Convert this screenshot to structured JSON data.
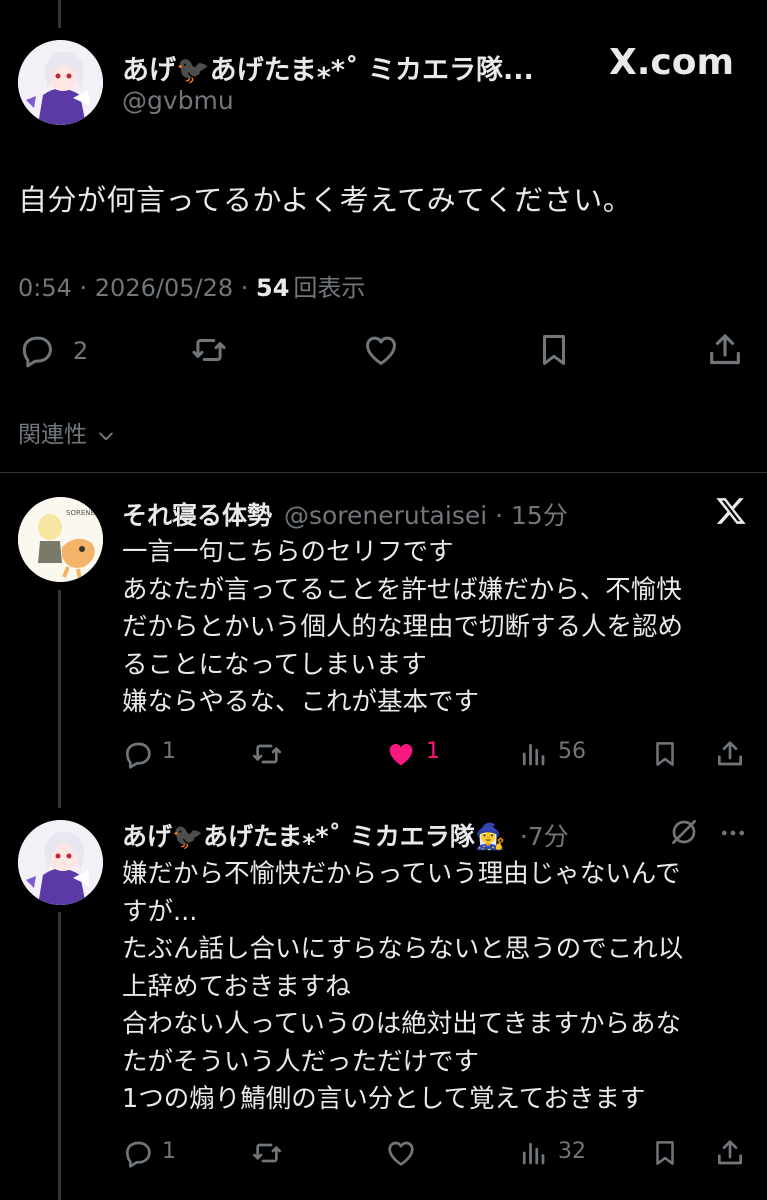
{
  "main_tweet": {
    "display_name": "あげ🐦‍⬛あげたま⁎*˚ ミカエラ隊...",
    "handle": "@gvbmu",
    "site_label": "X.com",
    "text": "自分が何言ってるかよく考えてみてください。",
    "timestamp": "0:54 · 2026/05/28 · ",
    "views_count": "54",
    "views_label": "回表示",
    "reply_count": "2",
    "relevance_label": "関連性"
  },
  "replies": [
    {
      "display_name": "それ寝る体勢",
      "handle": "@sorenerutaisei",
      "time": "· 15分",
      "lines": [
        "一言一句こちらのセリフです",
        "あなたが言ってることを許せば嫌だから、不愉快",
        "だからとかいう個人的な理由で切断する人を認め",
        "ることになってしまいます",
        "嫌ならやるな、これが基本です"
      ],
      "reply_count": "1",
      "like_count": "1",
      "view_count": "56",
      "liked": true
    },
    {
      "display_name": "あげ🐦‍⬛あげたま⁎*˚ ミカエラ隊🧙‍♀️",
      "time": "·7分",
      "lines": [
        "嫌だから不愉快だからっていう理由じゃないんで",
        "すが...",
        "たぶん話し合いにすらならないと思うのでこれ以",
        "上辞めておきますね",
        "合わない人っていうのは絶対出てきますからあな",
        "たがそういう人だっただけです",
        "1つの煽り鯖側の言い分として覚えておきます"
      ],
      "reply_count": "1",
      "view_count": "32",
      "liked": false
    }
  ],
  "colors": {
    "background": "#000000",
    "text": "#e7e9ea",
    "muted": "#71767b",
    "like": "#f91880",
    "divider": "#2f3336"
  }
}
